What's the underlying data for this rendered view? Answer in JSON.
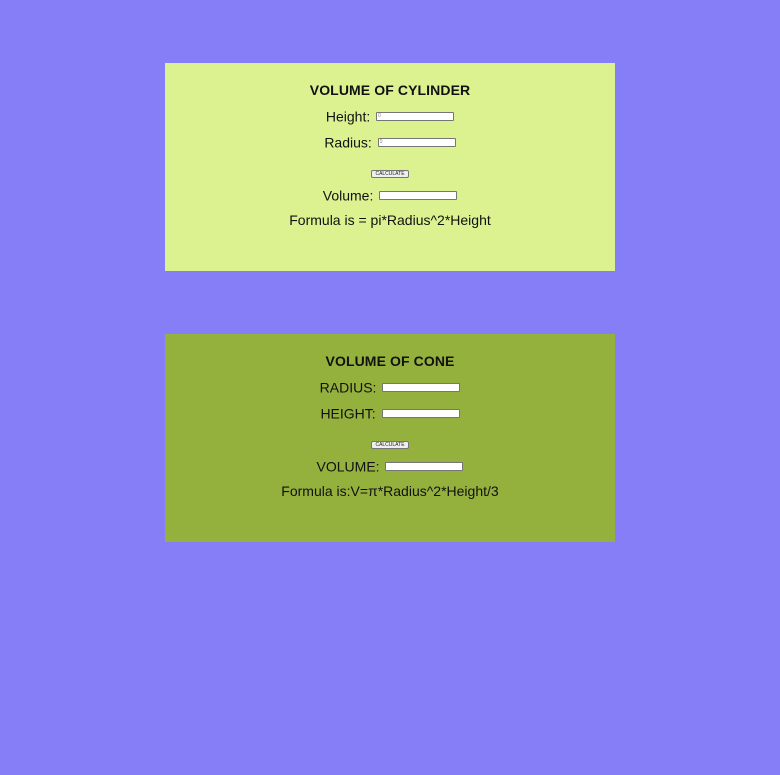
{
  "page": {
    "background_color": "#857ef6"
  },
  "cylinder": {
    "background_color": "#dcf291",
    "title": "VOLUME OF CYLINDER",
    "height_label": "Height:",
    "height_value": "0",
    "radius_label": "Radius:",
    "radius_value": "0",
    "calculate_label": "CALCULATE",
    "volume_label": "Volume:",
    "volume_value": "",
    "formula": "Formula is = pi*Radius^2*Height"
  },
  "cone": {
    "background_color": "#95b13d",
    "title": "VOLUME OF CONE",
    "radius_label": "RADIUS:",
    "radius_value": "",
    "height_label": "HEIGHT:",
    "height_value": "",
    "calculate_label": "CALCULATE",
    "volume_label": "VOLUME:",
    "volume_value": "",
    "formula": "Formula is:V=π*Radius^2*Height/3"
  }
}
